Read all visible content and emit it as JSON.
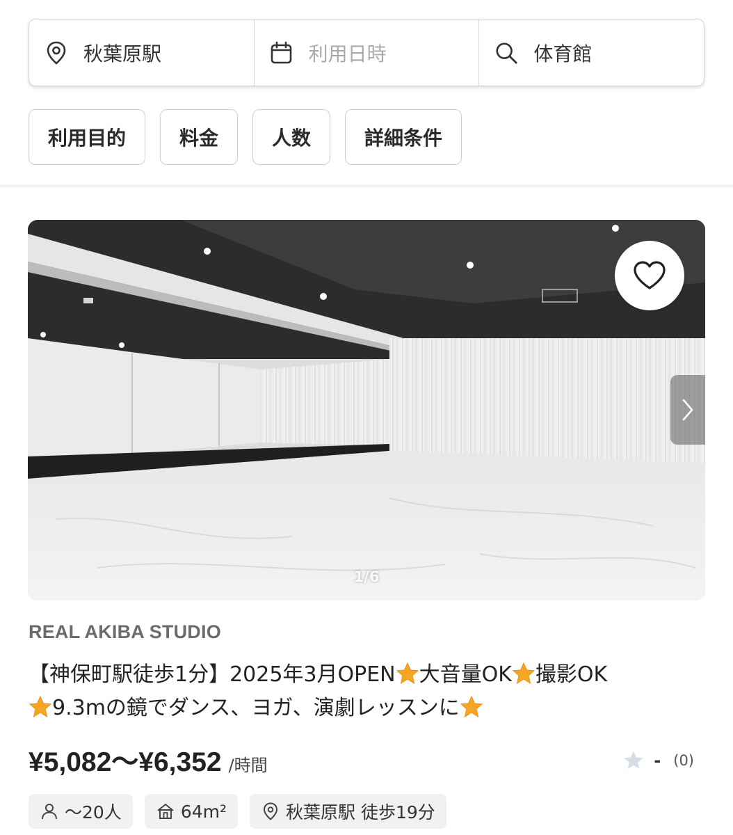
{
  "search": {
    "location": "秋葉原駅",
    "datetime_placeholder": "利用日時",
    "keyword": "体育館"
  },
  "filters": [
    "利用目的",
    "料金",
    "人数",
    "詳細条件"
  ],
  "listing": {
    "photo_counter": "1/6",
    "studio_name": "REAL AKIBA STUDIO",
    "title_parts": [
      "【神保町駅徒歩1分】2025年3月OPEN",
      "大音量OK",
      "撮影OK",
      "9.3mの鏡でダンス、ヨガ、演劇レッスンに"
    ],
    "price": "¥5,082〜¥6,352",
    "price_unit": "/時間",
    "rating_value": "-",
    "review_count": "(0)",
    "capacity": "〜20人",
    "area": "64m²",
    "access": "秋葉原駅 徒歩19分"
  },
  "icons": {
    "location": "map-pin-icon",
    "datetime": "calendar-icon",
    "keyword": "search-icon",
    "favorite": "heart-icon",
    "next": "chevron-right-icon",
    "title_emoji": "star-emoji",
    "rating": "star-icon",
    "capacity": "person-icon",
    "area": "house-icon",
    "access": "map-pin-icon"
  },
  "colors": {
    "star_emoji": "#f6a623",
    "rating_star_empty": "#d7dde2",
    "border": "#d6d6d6",
    "tag_bg": "#f1f1f1"
  }
}
